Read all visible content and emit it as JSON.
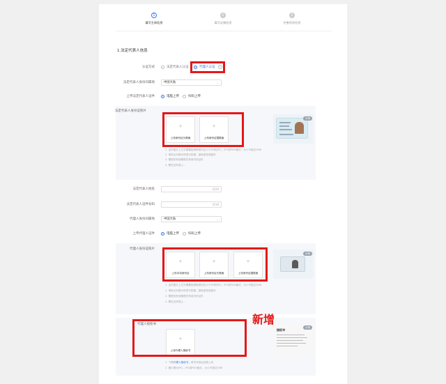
{
  "steps": [
    {
      "number": "1",
      "label": "填写主体信息",
      "active": true
    },
    {
      "number": "2",
      "label": "填写店铺信息",
      "active": false
    },
    {
      "number": "3",
      "label": "完善资质信息",
      "active": false
    }
  ],
  "section_title": "1.法定代表人信息",
  "cert_method": {
    "label": "认证方式",
    "options": [
      "法定代表人认证",
      "代理人认证"
    ],
    "selected": "代理人认证"
  },
  "legal_rep": {
    "region_label": "法定代表人身份归属地",
    "region_value": "中国大陆",
    "id_upload_label": "上传法定代表人证件",
    "upload_options": [
      "电脑上传",
      "扫码上传"
    ],
    "photo_label": "法定代表人身份证照片",
    "boxes": [
      "上传身份证头像面",
      "上传身份证国徽面"
    ],
    "example_badge": "示例",
    "tips": [
      "1. 证件图片上文字需要能清晰辨识且小于5M的JPG、JPG或PNG格式，大小不超过5MB",
      "2. 请务必对照示例进行拍摄，避免遮挡和缺失",
      "3. 需提供有效期限在有效内的证件",
      "4. 需在证件照上…"
    ],
    "name_label": "法定代表人姓名",
    "name_counter": "0/20",
    "id_label": "法定代表人证件号码",
    "id_counter": "0/18"
  },
  "agent": {
    "region_label": "代理人身份归属地",
    "region_value": "中国大陆",
    "id_upload_label": "上传代理人证件",
    "upload_options": [
      "电脑上传",
      "扫码上传"
    ],
    "photo_label": "代理人身份证照片",
    "boxes": [
      "上传手持身份证",
      "上传身份证头像面",
      "上传身份证国徽面"
    ],
    "example_badge": "示例",
    "tips": [
      "1. 证件图片上文字需要能清晰辨识且小于5M的JPG、JPG或PNG格式，大小不超过5MB",
      "2. 请务必对照示例进行拍摄，避免遮挡和缺失",
      "3. 需提供有效期限在有效内的证件",
      "4. 需在证件照上…"
    ]
  },
  "authorization": {
    "label": "代理人授权书",
    "box": "上传代理人授权书",
    "example_badge": "示例",
    "example_title": "授权书",
    "tips": [
      "1. 下载代理人授权书，填写完成后拍照上传",
      "2. 图片需为JPG、JPG或PNG格式，大小不超过5MB"
    ],
    "download_link": "代理人授权书"
  },
  "annotation": "新增",
  "colors": {
    "accent": "#3377ee",
    "highlight": "#e31818",
    "background": "#f0f0f0"
  }
}
